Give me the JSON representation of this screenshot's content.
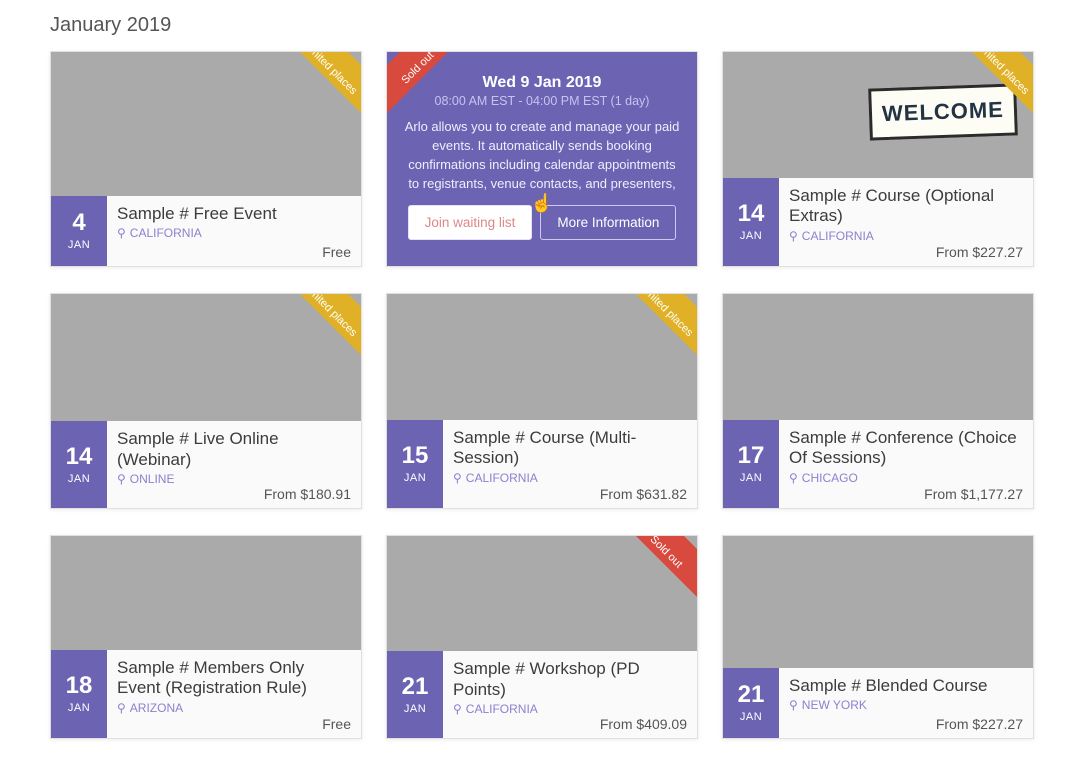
{
  "page": {
    "heading": "January 2019"
  },
  "ribbons": {
    "limited": "Limited places",
    "soldout": "Sold out"
  },
  "expanded": {
    "date_line": "Wed 9 Jan 2019",
    "time_line": "08:00 AM EST - 04:00 PM EST (1 day)",
    "description": "Arlo allows you to create and manage your paid events. It automatically sends booking confirmations including calendar appointments to registrants, venue contacts, and presenters,",
    "waitlist_label": "Join waiting list",
    "moreinfo_label": "More Information"
  },
  "welcome_sign": "WELCOME",
  "cards": [
    {
      "day": "4",
      "mon": "JAN",
      "title": "Sample # Free Event",
      "loc": "CALIFORNIA",
      "price": "Free",
      "ribbon": "limited",
      "bg": "bg1"
    },
    {
      "expanded": true,
      "ribbon": "soldout"
    },
    {
      "day": "14",
      "mon": "JAN",
      "title": "Sample # Course (Optional Extras)",
      "loc": "CALIFORNIA",
      "price": "From $227.27",
      "ribbon": "limited",
      "bg": "bg5",
      "welcome": true,
      "tall": true
    },
    {
      "day": "14",
      "mon": "JAN",
      "title": "Sample # Live Online (Webinar)",
      "loc": "ONLINE",
      "price": "From $180.91",
      "ribbon": "limited",
      "bg": "bg2"
    },
    {
      "day": "15",
      "mon": "JAN",
      "title": "Sample # Course (Multi-Session)",
      "loc": "CALIFORNIA",
      "price": "From $631.82",
      "ribbon": "limited",
      "bg": "bg3",
      "tall": true
    },
    {
      "day": "17",
      "mon": "JAN",
      "title": "Sample # Conference (Choice Of Sessions)",
      "loc": "CHICAGO",
      "price": "From $1,177.27",
      "bg": "bg4",
      "tall": true
    },
    {
      "day": "18",
      "mon": "JAN",
      "title": "Sample # Members Only Event (Registration Rule)",
      "loc": "ARIZONA",
      "price": "Free",
      "bg": "bg8",
      "tall": true,
      "cut": true
    },
    {
      "day": "21",
      "mon": "JAN",
      "title": "Sample # Workshop (PD Points)",
      "loc": "CALIFORNIA",
      "price": "From $409.09",
      "ribbon": "soldout",
      "bg": "bg6",
      "cut": true
    },
    {
      "day": "21",
      "mon": "JAN",
      "title": "Sample # Blended Course",
      "loc": "NEW YORK",
      "price": "From $227.27",
      "bg": "bg7",
      "cut": true
    }
  ]
}
